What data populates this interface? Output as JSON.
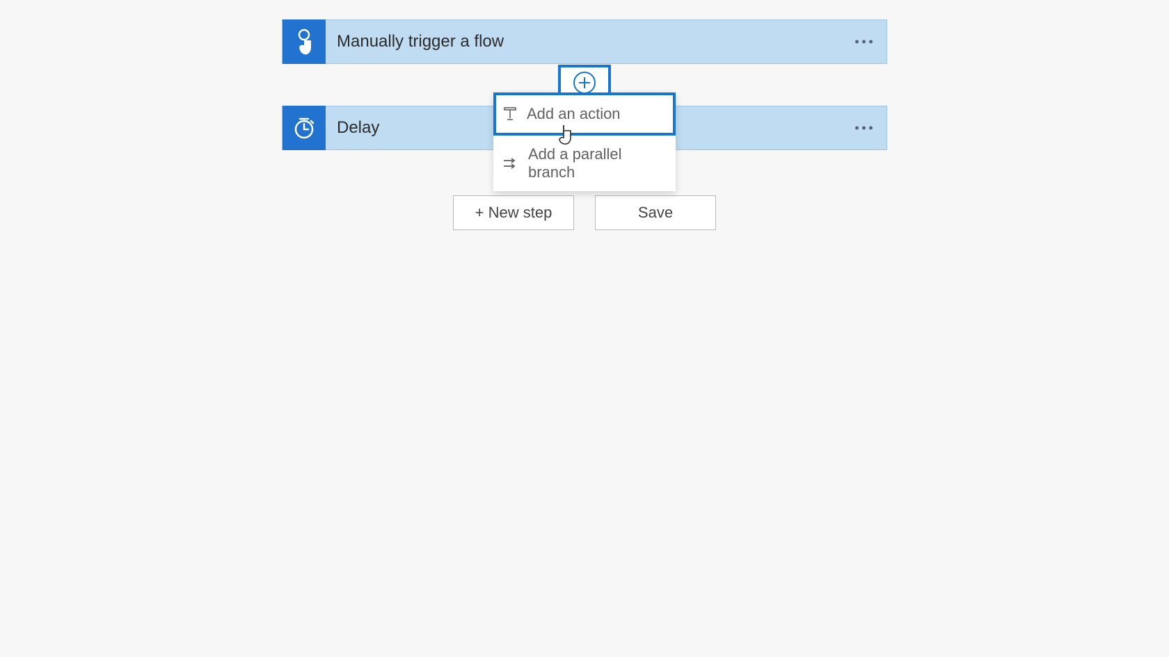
{
  "flow": {
    "trigger": {
      "title": "Manually trigger a flow"
    },
    "action": {
      "title": "Delay"
    }
  },
  "plusMenu": {
    "addAction": "Add an action",
    "addParallel": "Add a parallel branch"
  },
  "buttons": {
    "newStep": "+ New step",
    "save": "Save"
  }
}
